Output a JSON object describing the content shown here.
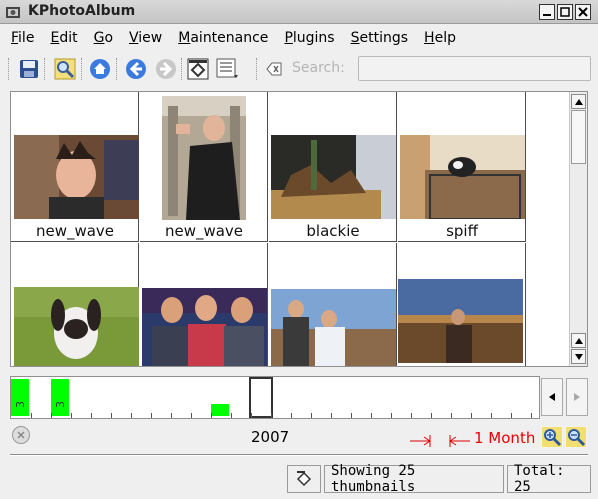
{
  "window": {
    "title": "KPhotoAlbum"
  },
  "menu": [
    {
      "label": "File",
      "key": "F",
      "rest": "ile"
    },
    {
      "label": "Edit",
      "key": "E",
      "rest": "dit"
    },
    {
      "label": "Go",
      "key": "G",
      "rest": "o"
    },
    {
      "label": "View",
      "key": "V",
      "rest": "iew"
    },
    {
      "label": "Maintenance",
      "key": "M",
      "rest": "aintenance"
    },
    {
      "label": "Plugins",
      "key": "P",
      "rest": "lugins"
    },
    {
      "label": "Settings",
      "key": "S",
      "rest": "ettings"
    },
    {
      "label": "Help",
      "key": "H",
      "rest": "elp"
    }
  ],
  "toolbar": {
    "icons": [
      "save-icon",
      "search-images-icon",
      "home-icon",
      "back-icon",
      "forward-icon",
      "thumbnail-view-icon",
      "list-view-icon"
    ],
    "search_label": "Search:",
    "search_value": "",
    "search_placeholder": ""
  },
  "thumbnails": [
    {
      "caption": "new_wave"
    },
    {
      "caption": "new_wave"
    },
    {
      "caption": "blackie"
    },
    {
      "caption": "spiff"
    },
    {
      "caption": ""
    },
    {
      "caption": ""
    },
    {
      "caption": ""
    },
    {
      "caption": ""
    }
  ],
  "datebar": {
    "bars": [
      {
        "count": "3",
        "color": "#00ff00"
      },
      {
        "count": "3",
        "color": "#00ff00"
      },
      {
        "count": "",
        "color": "#00ff00"
      }
    ],
    "year": "2007",
    "unit": "1 Month"
  },
  "status": {
    "thumbnails": "Showing 25 thumbnails",
    "total": "Total: 25"
  },
  "colors": {
    "bar": "#00ff00",
    "unit_marker": "#e00000"
  }
}
